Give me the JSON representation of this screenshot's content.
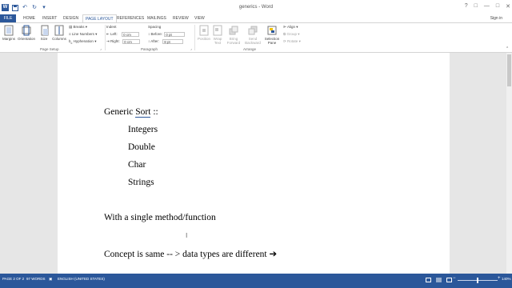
{
  "window": {
    "title": "generics - Word",
    "app_icon": "W",
    "controls": [
      "?",
      "□",
      "—",
      "□",
      "✕"
    ]
  },
  "qat": {
    "save_icon": "save-icon",
    "undo_icon": "undo-icon",
    "redo_icon": "redo-icon"
  },
  "tabs": {
    "file": "FILE",
    "home": "HOME",
    "insert": "INSERT",
    "design": "DESIGN",
    "page_layout": "PAGE LAYOUT",
    "references": "REFERENCES",
    "mailings": "MAILINGS",
    "review": "REVIEW",
    "view": "VIEW",
    "signin": "Sign in"
  },
  "ribbon": {
    "page_setup": {
      "margins": "Margins",
      "orientation": "Orientation",
      "size": "Size",
      "columns": "Columns",
      "breaks": "Breaks",
      "line_numbers": "Line Numbers",
      "hyphenation": "Hyphenation",
      "label": "Page Setup"
    },
    "paragraph": {
      "indent_label": "Indent",
      "left_label": "Left:",
      "left_value": "0 cm",
      "right_label": "Right:",
      "right_value": "0 cm",
      "spacing_label": "Spacing",
      "before_label": "Before:",
      "before_value": "0 pt",
      "after_label": "After:",
      "after_value": "8 pt",
      "label": "Paragraph"
    },
    "arrange": {
      "position": "Position",
      "wrap_text": "Wrap Text",
      "bring_forward": "Bring Forward",
      "send_backward": "Send Backward",
      "selection_pane": "Selection Pane",
      "align": "Align",
      "group": "Group",
      "rotate": "Rotate",
      "label": "Arrange"
    }
  },
  "document": {
    "heading_prefix": "Generic ",
    "heading_word": "Sort",
    "heading_suffix": " ::",
    "items": [
      "Integers",
      "Double",
      "Char",
      "Strings"
    ],
    "line_method": "With a single method/function",
    "line_concept": "Concept is same -- > data types are different ➔"
  },
  "status": {
    "page": "PAGE 2 OF 2",
    "words": "97 WORDS",
    "language": "ENGLISH (UNITED STATES)",
    "zoom": "140%"
  },
  "colors": {
    "accent": "#2b579a"
  }
}
